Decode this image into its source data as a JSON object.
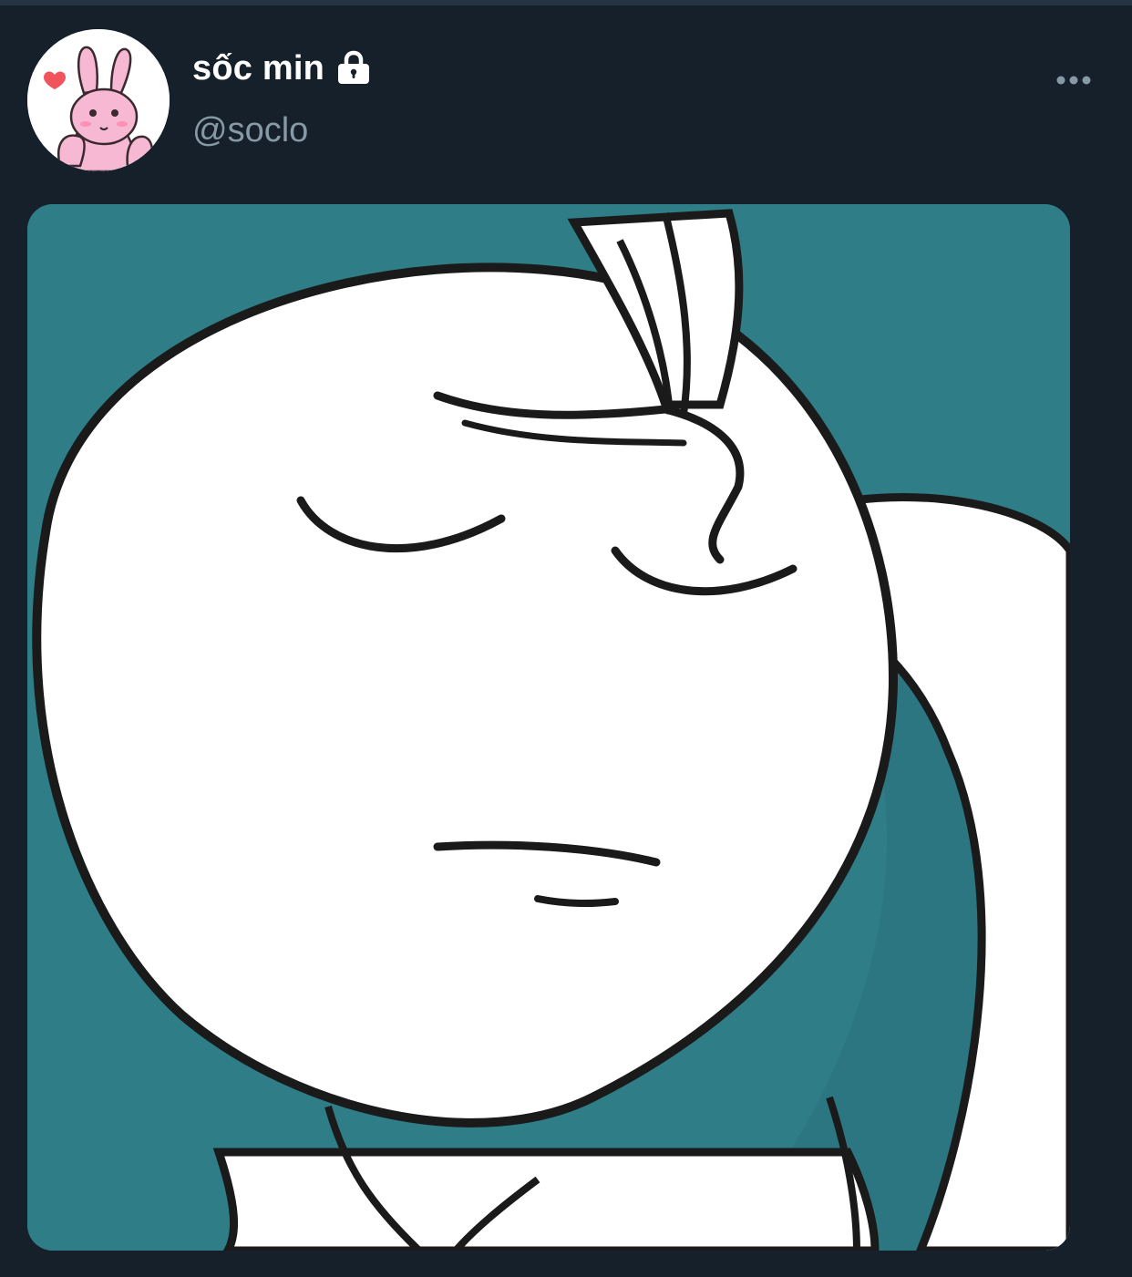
{
  "tweet": {
    "author": {
      "display_name": "sốc min",
      "handle": "@soclo",
      "avatar_icon": "pink-bunny-avatar",
      "protected_icon": "lock-icon"
    },
    "more_icon": "more-options-icon",
    "media": {
      "icon": "facepalm-cartoon-image"
    }
  },
  "colors": {
    "background": "#15202b",
    "text_primary": "#ffffff",
    "text_secondary": "#8899a6",
    "media_background": "#2f7d87"
  }
}
